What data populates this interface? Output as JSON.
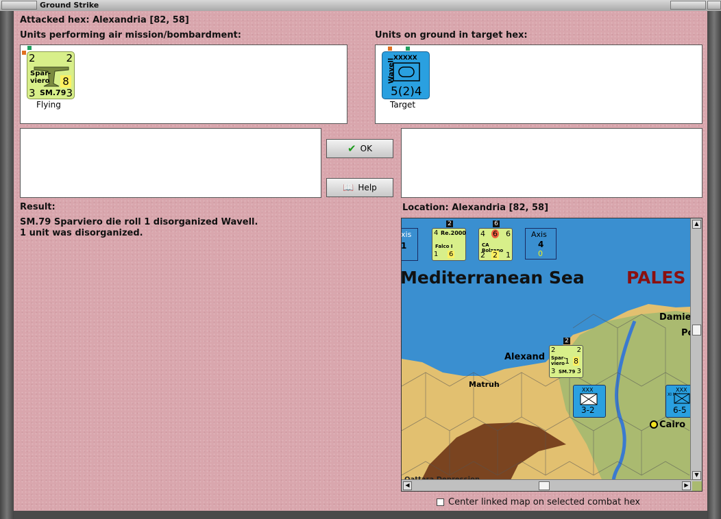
{
  "window": {
    "title": "Ground Strike"
  },
  "header": {
    "attacked_hex": "Attacked hex: Alexandria  [82, 58]"
  },
  "air_units": {
    "label": "Units performing air mission/bombardment:",
    "items": [
      {
        "tl": "2",
        "tr": "2",
        "name1": "Spar-",
        "name2": "viero",
        "val": "8",
        "type": "SM.79",
        "bl": "3",
        "br": "3",
        "status": "Flying"
      }
    ]
  },
  "ground_units": {
    "label": "Units on ground in target hex:",
    "items": [
      {
        "size": "XXXXX",
        "name": "Wavell",
        "strength": "5(2)4",
        "status": "Target"
      }
    ]
  },
  "buttons": {
    "ok": "OK",
    "help": "Help"
  },
  "result": {
    "label": "Result:",
    "line1": "SM.79 Sparviero die roll 1 disorganized Wavell.",
    "line2": "1 unit was disorganized."
  },
  "location": {
    "label": "Location:  Alexandria  [82, 58]"
  },
  "map": {
    "sea_label": "Mediterranean Sea",
    "country_label": "PALES",
    "places": [
      "Alexand",
      "Matruh",
      "Cairo",
      "Damie",
      "Po",
      "Qattara Depression"
    ],
    "counters": [
      {
        "top": "Re.2000",
        "mid": "Falco I",
        "a": "4",
        "b": "1",
        "c": "6",
        "badge": "2"
      },
      {
        "top": "CA Bolzano",
        "a": "4",
        "b": "6",
        "c": "6",
        "d": "2",
        "e": "2",
        "f": "1",
        "badge": "6"
      },
      {
        "top": "Axis",
        "val": "4",
        "sub": "0"
      },
      {
        "top": "xis",
        "val": "1"
      },
      {
        "a": "2",
        "b": "2",
        "c": "1",
        "d": "8",
        "e": "3",
        "f": "3",
        "type": "SM.79",
        "name1": "Spar-",
        "name2": "viero",
        "badge": "2"
      },
      {
        "size": "XXX",
        "strength": "3-2"
      },
      {
        "size": "XXX",
        "strength": "6-5",
        "name": "XI Mot"
      }
    ]
  },
  "footer": {
    "checkbox_label": "Center linked map on selected combat hex",
    "checked": false
  }
}
